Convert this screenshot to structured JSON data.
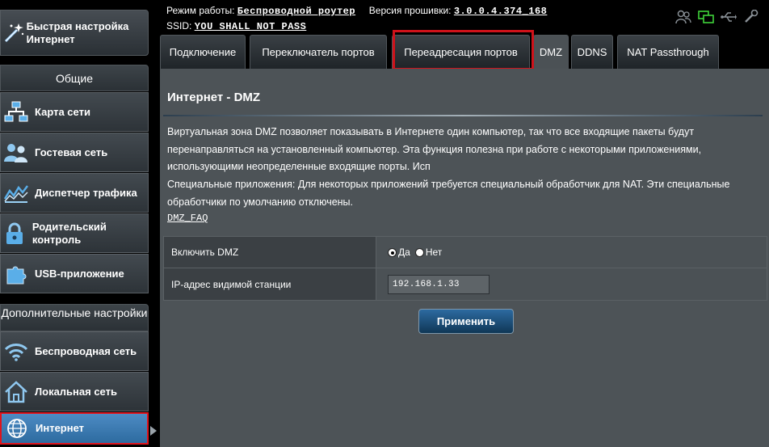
{
  "topbar": {
    "mode_label": "Режим работы:",
    "mode_value": "Беспроводной роутер",
    "firmware_label": "Версия прошивки:",
    "firmware_value": "3.0.0.4.374_168",
    "ssid_label": "SSID:",
    "ssid_value": "YOU SHALL NOT PASS",
    "status_icons": [
      "users-icon",
      "network-status-icon",
      "usb-icon",
      "settings-icon"
    ]
  },
  "sidebar": {
    "quick_setup": "Быстрая настройка Интернет",
    "general_header": "Общие",
    "general_items": [
      {
        "label": "Карта сети",
        "icon": "network-map-icon"
      },
      {
        "label": "Гостевая сеть",
        "icon": "guest-network-icon"
      },
      {
        "label": "Диспетчер трафика",
        "icon": "traffic-manager-icon"
      },
      {
        "label": "Родительский контроль",
        "icon": "lock-icon"
      },
      {
        "label": "USB-приложение",
        "icon": "puzzle-icon"
      }
    ],
    "advanced_header": "Дополнительные настройки",
    "advanced_items": [
      {
        "label": "Беспроводная сеть",
        "icon": "wifi-icon"
      },
      {
        "label": "Локальная сеть",
        "icon": "home-icon"
      },
      {
        "label": "Интернет",
        "icon": "globe-icon"
      }
    ]
  },
  "tabs": [
    {
      "label": "Подключение"
    },
    {
      "label": "Переключатель портов"
    },
    {
      "label": "Переадресация портов"
    },
    {
      "label": "DMZ"
    },
    {
      "label": "DDNS"
    },
    {
      "label": "NAT Passthrough"
    }
  ],
  "active_tab": "DMZ",
  "main": {
    "title": "Интернет - DMZ",
    "description_lines": [
      "Виртуальная зона DMZ позволяет показывать в Интернете один компьютер, так что все входящие пакеты будут",
      "перенаправляться на установленный компьютер. Эта функция полезна при работе с некоторыми приложениями,",
      "использующими неопределенные входящие порты. Исп",
      "Специальные приложения: Для некоторых приложений требуется специальный обработчик для NAT. Эти специальные",
      "обработчики по умолчанию отключены."
    ],
    "faq_link": "DMZ_FAQ",
    "enable_dmz_label": "Включить DMZ",
    "radio_yes": "Да",
    "radio_no": "Нет",
    "enable_dmz_value": "yes",
    "ip_label": "IP-адрес видимой станции",
    "ip_value": "192.168.1.33",
    "apply_button": "Применить"
  },
  "colors": {
    "highlight": "#d0121a",
    "active_item": "#3d7bb3",
    "panel_bg": "#4d5357"
  }
}
